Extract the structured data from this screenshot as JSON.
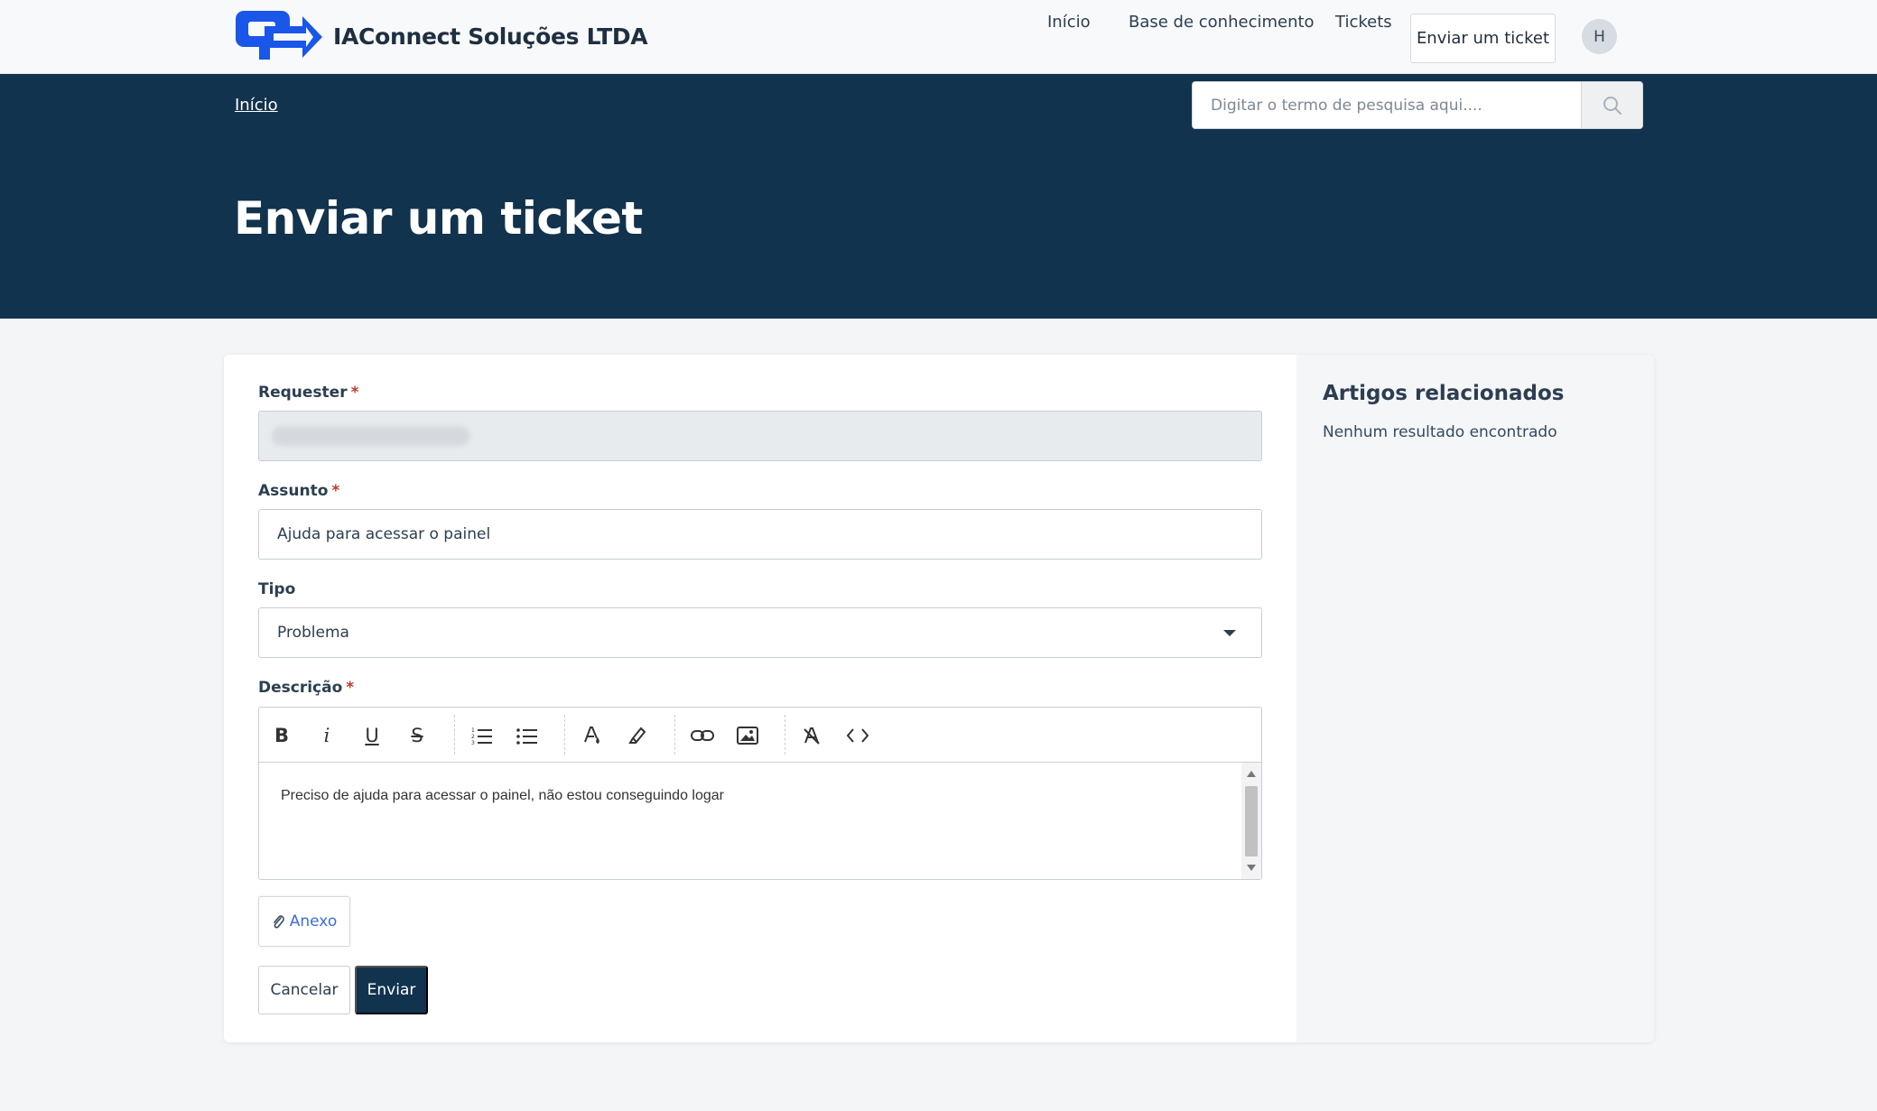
{
  "header": {
    "brand_name": "IAConnect Soluções LTDA",
    "nav": [
      "Início",
      "Base de conhecimento",
      "Tickets"
    ],
    "cta": "Enviar um ticket",
    "avatar_initial": "H"
  },
  "hero": {
    "breadcrumb": "Início",
    "search_placeholder": "Digitar o termo de pesquisa aqui....",
    "title": "Enviar um ticket"
  },
  "form": {
    "requester_label": "Requester",
    "subject_label": "Assunto",
    "subject_value": "Ajuda para acessar o painel",
    "type_label": "Tipo",
    "type_value": "Problema",
    "description_label": "Descrição",
    "description_value": "Preciso de ajuda para acessar o painel, não estou conseguindo logar",
    "required_mark": "*",
    "toolbar": {
      "bold": "B",
      "italic": "i",
      "underline": "U",
      "strike": "S"
    },
    "attach_label": "Anexo",
    "cancel_label": "Cancelar",
    "submit_label": "Enviar"
  },
  "sidebar": {
    "title": "Artigos relacionados",
    "empty": "Nenhum resultado encontrado"
  },
  "colors": {
    "hero_bg": "#12334d",
    "brand_blue": "#1a56e8",
    "link_blue": "#3b6fd4",
    "required_red": "#c0392b"
  }
}
